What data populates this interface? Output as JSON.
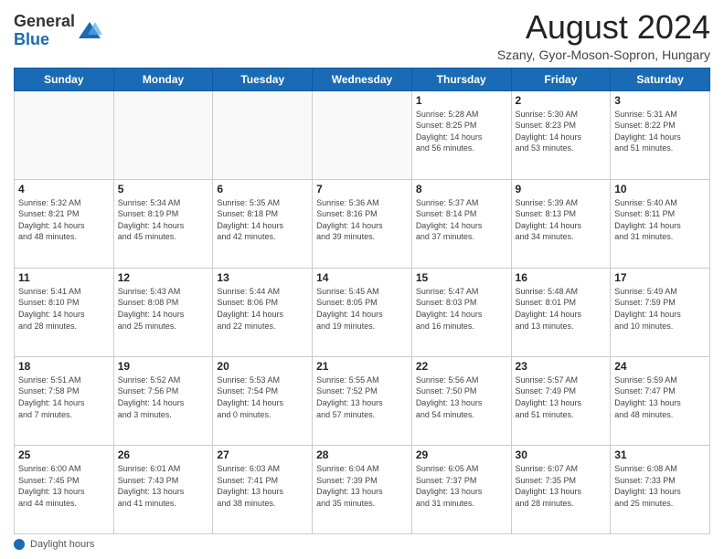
{
  "header": {
    "logo_general": "General",
    "logo_blue": "Blue",
    "month_year": "August 2024",
    "location": "Szany, Gyor-Moson-Sopron, Hungary"
  },
  "days_of_week": [
    "Sunday",
    "Monday",
    "Tuesday",
    "Wednesday",
    "Thursday",
    "Friday",
    "Saturday"
  ],
  "weeks": [
    [
      {
        "day": "",
        "info": ""
      },
      {
        "day": "",
        "info": ""
      },
      {
        "day": "",
        "info": ""
      },
      {
        "day": "",
        "info": ""
      },
      {
        "day": "1",
        "info": "Sunrise: 5:28 AM\nSunset: 8:25 PM\nDaylight: 14 hours\nand 56 minutes."
      },
      {
        "day": "2",
        "info": "Sunrise: 5:30 AM\nSunset: 8:23 PM\nDaylight: 14 hours\nand 53 minutes."
      },
      {
        "day": "3",
        "info": "Sunrise: 5:31 AM\nSunset: 8:22 PM\nDaylight: 14 hours\nand 51 minutes."
      }
    ],
    [
      {
        "day": "4",
        "info": "Sunrise: 5:32 AM\nSunset: 8:21 PM\nDaylight: 14 hours\nand 48 minutes."
      },
      {
        "day": "5",
        "info": "Sunrise: 5:34 AM\nSunset: 8:19 PM\nDaylight: 14 hours\nand 45 minutes."
      },
      {
        "day": "6",
        "info": "Sunrise: 5:35 AM\nSunset: 8:18 PM\nDaylight: 14 hours\nand 42 minutes."
      },
      {
        "day": "7",
        "info": "Sunrise: 5:36 AM\nSunset: 8:16 PM\nDaylight: 14 hours\nand 39 minutes."
      },
      {
        "day": "8",
        "info": "Sunrise: 5:37 AM\nSunset: 8:14 PM\nDaylight: 14 hours\nand 37 minutes."
      },
      {
        "day": "9",
        "info": "Sunrise: 5:39 AM\nSunset: 8:13 PM\nDaylight: 14 hours\nand 34 minutes."
      },
      {
        "day": "10",
        "info": "Sunrise: 5:40 AM\nSunset: 8:11 PM\nDaylight: 14 hours\nand 31 minutes."
      }
    ],
    [
      {
        "day": "11",
        "info": "Sunrise: 5:41 AM\nSunset: 8:10 PM\nDaylight: 14 hours\nand 28 minutes."
      },
      {
        "day": "12",
        "info": "Sunrise: 5:43 AM\nSunset: 8:08 PM\nDaylight: 14 hours\nand 25 minutes."
      },
      {
        "day": "13",
        "info": "Sunrise: 5:44 AM\nSunset: 8:06 PM\nDaylight: 14 hours\nand 22 minutes."
      },
      {
        "day": "14",
        "info": "Sunrise: 5:45 AM\nSunset: 8:05 PM\nDaylight: 14 hours\nand 19 minutes."
      },
      {
        "day": "15",
        "info": "Sunrise: 5:47 AM\nSunset: 8:03 PM\nDaylight: 14 hours\nand 16 minutes."
      },
      {
        "day": "16",
        "info": "Sunrise: 5:48 AM\nSunset: 8:01 PM\nDaylight: 14 hours\nand 13 minutes."
      },
      {
        "day": "17",
        "info": "Sunrise: 5:49 AM\nSunset: 7:59 PM\nDaylight: 14 hours\nand 10 minutes."
      }
    ],
    [
      {
        "day": "18",
        "info": "Sunrise: 5:51 AM\nSunset: 7:58 PM\nDaylight: 14 hours\nand 7 minutes."
      },
      {
        "day": "19",
        "info": "Sunrise: 5:52 AM\nSunset: 7:56 PM\nDaylight: 14 hours\nand 3 minutes."
      },
      {
        "day": "20",
        "info": "Sunrise: 5:53 AM\nSunset: 7:54 PM\nDaylight: 14 hours\nand 0 minutes."
      },
      {
        "day": "21",
        "info": "Sunrise: 5:55 AM\nSunset: 7:52 PM\nDaylight: 13 hours\nand 57 minutes."
      },
      {
        "day": "22",
        "info": "Sunrise: 5:56 AM\nSunset: 7:50 PM\nDaylight: 13 hours\nand 54 minutes."
      },
      {
        "day": "23",
        "info": "Sunrise: 5:57 AM\nSunset: 7:49 PM\nDaylight: 13 hours\nand 51 minutes."
      },
      {
        "day": "24",
        "info": "Sunrise: 5:59 AM\nSunset: 7:47 PM\nDaylight: 13 hours\nand 48 minutes."
      }
    ],
    [
      {
        "day": "25",
        "info": "Sunrise: 6:00 AM\nSunset: 7:45 PM\nDaylight: 13 hours\nand 44 minutes."
      },
      {
        "day": "26",
        "info": "Sunrise: 6:01 AM\nSunset: 7:43 PM\nDaylight: 13 hours\nand 41 minutes."
      },
      {
        "day": "27",
        "info": "Sunrise: 6:03 AM\nSunset: 7:41 PM\nDaylight: 13 hours\nand 38 minutes."
      },
      {
        "day": "28",
        "info": "Sunrise: 6:04 AM\nSunset: 7:39 PM\nDaylight: 13 hours\nand 35 minutes."
      },
      {
        "day": "29",
        "info": "Sunrise: 6:05 AM\nSunset: 7:37 PM\nDaylight: 13 hours\nand 31 minutes."
      },
      {
        "day": "30",
        "info": "Sunrise: 6:07 AM\nSunset: 7:35 PM\nDaylight: 13 hours\nand 28 minutes."
      },
      {
        "day": "31",
        "info": "Sunrise: 6:08 AM\nSunset: 7:33 PM\nDaylight: 13 hours\nand 25 minutes."
      }
    ]
  ],
  "footer": {
    "label": "Daylight hours"
  }
}
